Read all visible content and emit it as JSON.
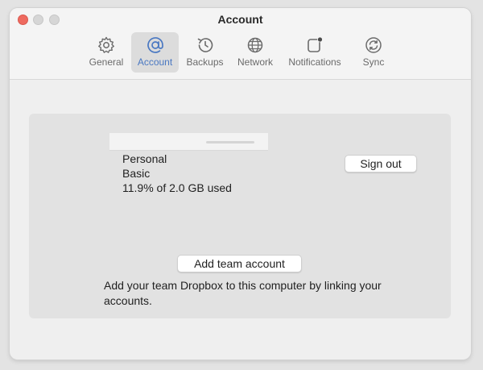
{
  "window": {
    "title": "Account"
  },
  "toolbar": {
    "tabs": [
      {
        "label": "General",
        "icon": "gear-icon"
      },
      {
        "label": "Account",
        "icon": "at-sign-icon",
        "selected": true
      },
      {
        "label": "Backups",
        "icon": "history-clock-icon"
      },
      {
        "label": "Network",
        "icon": "globe-icon"
      },
      {
        "label": "Notifications",
        "icon": "notification-badge-icon"
      },
      {
        "label": "Sync",
        "icon": "sync-arrows-icon"
      }
    ]
  },
  "account": {
    "plan_type": "Personal",
    "plan_tier": "Basic",
    "usage": "11.9% of 2.0 GB used",
    "sign_out_label": "Sign out",
    "add_team_label": "Add team account",
    "team_description": "Add your team Dropbox to this computer by linking your accounts."
  },
  "colors": {
    "accent": "#4a78c2",
    "close": "#ee6a5f",
    "window_bg": "#efefef",
    "panel_bg": "#e2e2e2"
  }
}
